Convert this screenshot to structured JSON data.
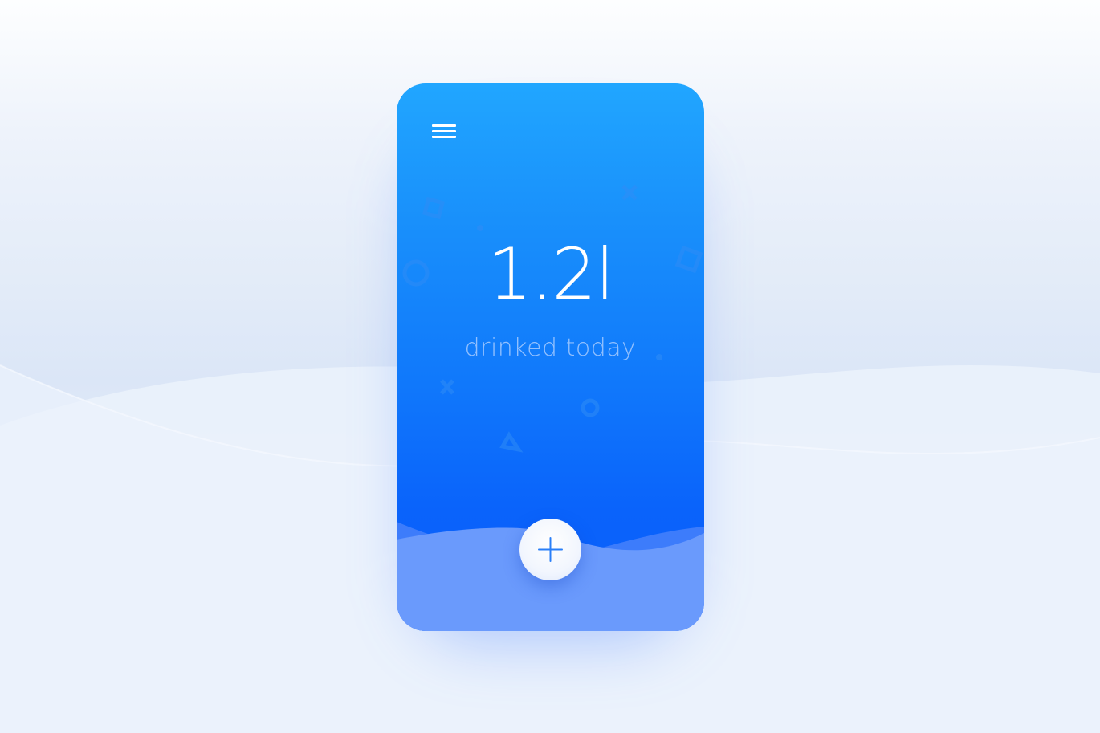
{
  "colors": {
    "phone_top": "#21a6ff",
    "phone_bottom": "#0a5efb",
    "water": "#6a9afc",
    "background": "#e2ebf8",
    "accent_icon": "#2a7ff8"
  },
  "header": {
    "menu_icon": "hamburger-menu-icon"
  },
  "stats": {
    "amount": "1.2l",
    "label": "drinked today"
  },
  "actions": {
    "add_icon": "plus-icon"
  }
}
